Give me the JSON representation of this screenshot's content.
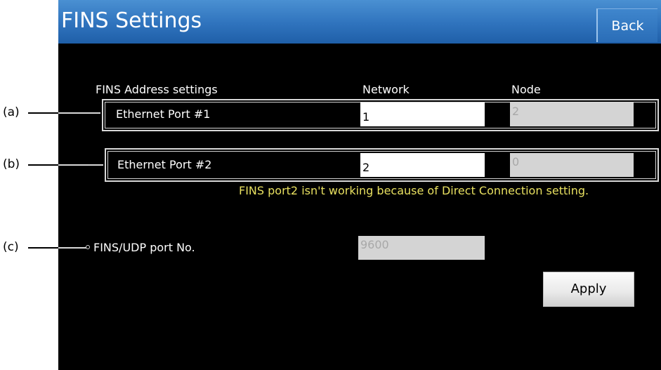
{
  "header": {
    "title": "FINS Settings",
    "back_label": "Back"
  },
  "fins_address": {
    "section_label": "FINS Address settings",
    "network_header": "Network",
    "node_header": "Node",
    "ports": [
      {
        "label": "Ethernet Port #1",
        "network": "1",
        "node": "2"
      },
      {
        "label": "Ethernet Port #2",
        "network": "2",
        "node": "0"
      }
    ],
    "warning": "FINS port2 isn't working because of Direct Connection setting."
  },
  "udp": {
    "label": "FINS/UDP port No.",
    "value": "9600"
  },
  "apply_label": "Apply",
  "callouts": {
    "a": "(a)",
    "b": "(b)",
    "c": "(c)"
  },
  "colors": {
    "title_bar": "#2f73bd",
    "screen_background": "#000000",
    "warning_text": "#e8e060"
  }
}
